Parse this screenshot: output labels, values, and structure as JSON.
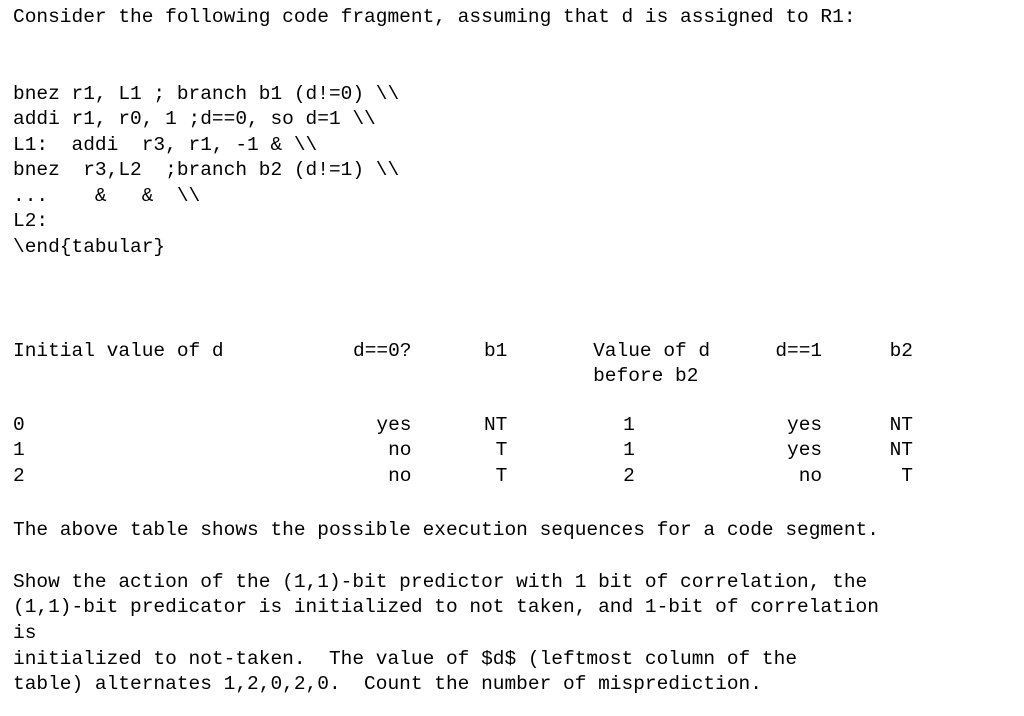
{
  "document": {
    "intro": "Consider the following code fragment, assuming that d is assigned to R1:",
    "code_lines": [
      "bnez r1, L1 ; branch b1 (d!=0) \\\\",
      "addi r1, r0, 1 ;d==0, so d=1 \\\\",
      "L1:  addi  r3, r1, -1 & \\\\",
      "bnez  r3,L2  ;branch b2 (d!=1) \\\\",
      "...    &   &  \\\\",
      "L2:",
      "\\end{tabular}"
    ],
    "table": {
      "headers": {
        "initial_value": "Initial value of d",
        "d_eq_0": "d==0?",
        "b1": "b1",
        "value_of_d_line1": "Value of d",
        "value_of_d_line2": "before b2",
        "d_eq_1": "d==1",
        "b2": "b2"
      },
      "rows": [
        {
          "initial_value": "0",
          "d_eq_0": "yes",
          "b1": "NT",
          "value_of_d": "1",
          "d_eq_1": "yes",
          "b2": "NT"
        },
        {
          "initial_value": "1",
          "d_eq_0": "no",
          "b1": "T",
          "value_of_d": "1",
          "d_eq_1": "yes",
          "b2": "NT"
        },
        {
          "initial_value": "2",
          "d_eq_0": "no",
          "b1": "T",
          "value_of_d": "2",
          "d_eq_1": "no",
          "b2": "T"
        }
      ]
    },
    "paragraph_after_table": "The above table shows the possible execution sequences for a code segment.",
    "question_lines": [
      "Show the action of the (1,1)-bit predictor with 1 bit of correlation, the",
      "(1,1)-bit predicator is initialized to not taken, and 1-bit of correlation",
      "is",
      "initialized to not-taken.  The value of $d$ (leftmost column of the",
      "table) alternates 1,2,0,2,0.  Count the number of misprediction."
    ]
  }
}
